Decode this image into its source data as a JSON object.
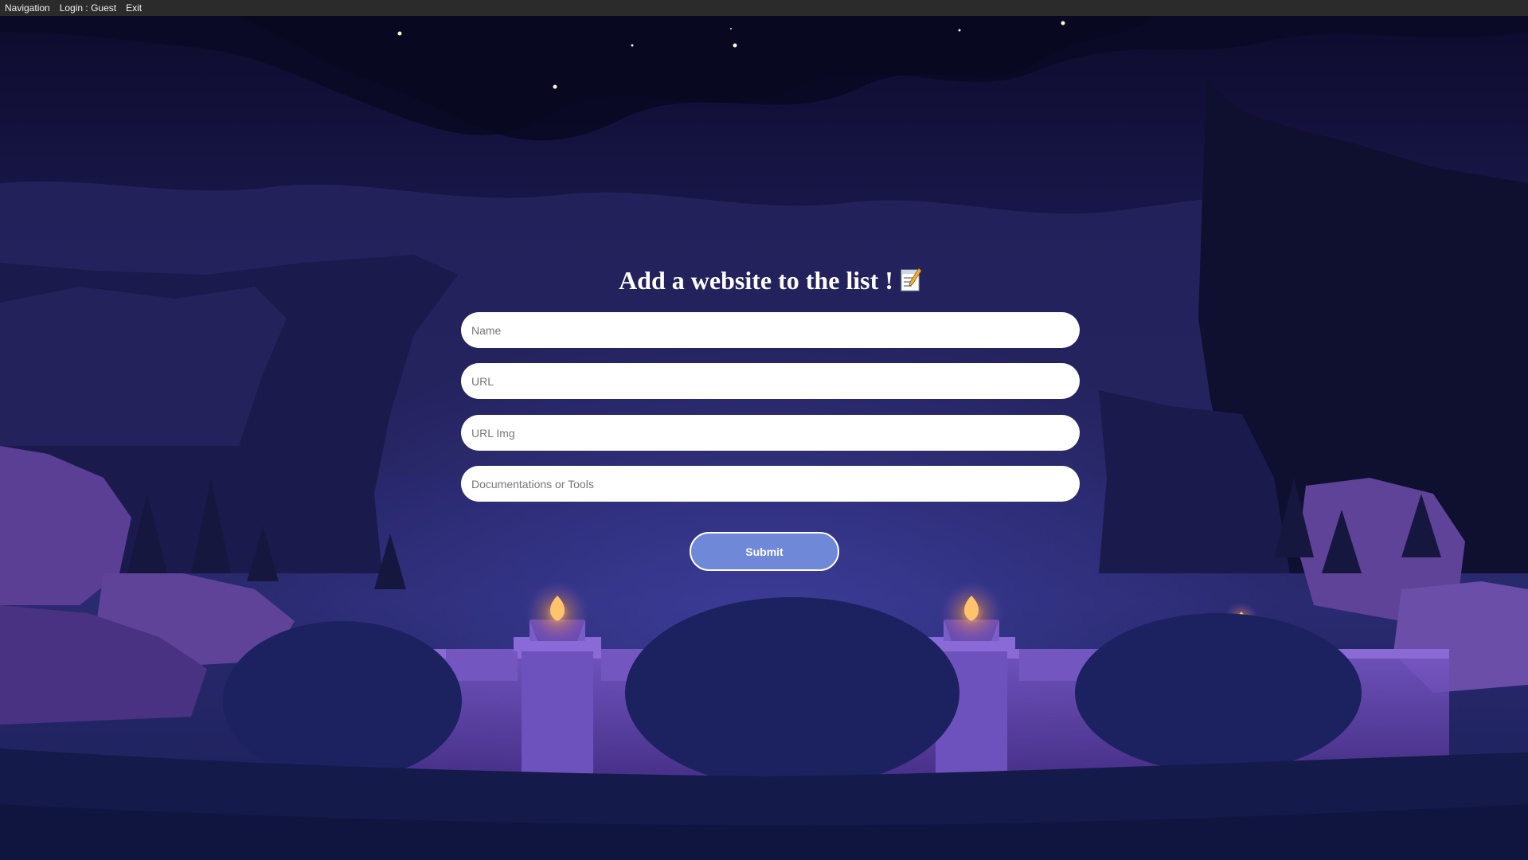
{
  "menubar": {
    "items": [
      {
        "label": "Navigation"
      },
      {
        "label": "Login : Guest"
      },
      {
        "label": "Exit"
      }
    ]
  },
  "form": {
    "title": "Add a website to the list !",
    "title_icon": "memo-icon",
    "fields": {
      "name": {
        "placeholder": "Name",
        "value": ""
      },
      "url": {
        "placeholder": "URL",
        "value": ""
      },
      "url_img": {
        "placeholder": "URL Img",
        "value": ""
      },
      "category": {
        "placeholder": "Documentations or Tools",
        "value": ""
      }
    },
    "submit_label": "Submit"
  },
  "colors": {
    "menubar_bg": "#2b2b2b",
    "sky_top": "#0c0a2a",
    "sky_mid": "#26246a",
    "submit_bg": "#6f88d8",
    "torch_flame": "#ffc36b",
    "ground": "#141a4a",
    "wall_purple": "#5b3e9c"
  }
}
